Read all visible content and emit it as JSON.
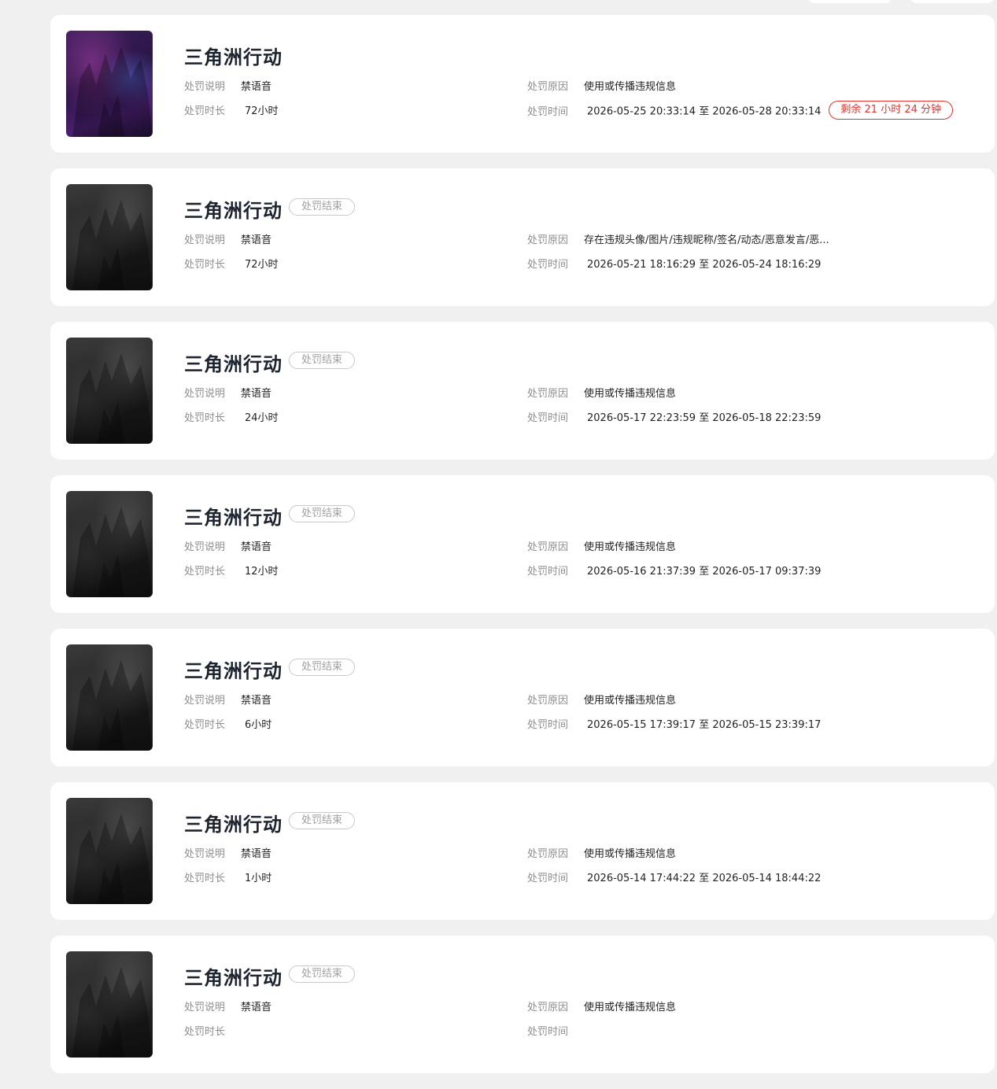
{
  "labels": {
    "desc": "处罚说明",
    "duration": "处罚时长",
    "reason": "处罚原因",
    "time": "处罚时间",
    "ended": "处罚结束"
  },
  "records": [
    {
      "game": "三角洲行动",
      "status": "active",
      "desc": "禁语音",
      "duration": "72小时",
      "reason": "使用或传播违规信息",
      "time": "2026-05-25 20:33:14 至 2026-05-28 20:33:14",
      "remaining": "剩余 21 小时 24 分钟"
    },
    {
      "game": "三角洲行动",
      "status": "ended",
      "desc": "禁语音",
      "duration": "72小时",
      "reason": "存在违规头像/图片/违规昵称/签名/动态/恶意发言/恶...",
      "time": "2026-05-21 18:16:29 至 2026-05-24 18:16:29"
    },
    {
      "game": "三角洲行动",
      "status": "ended",
      "desc": "禁语音",
      "duration": "24小时",
      "reason": "使用或传播违规信息",
      "time": "2026-05-17 22:23:59 至 2026-05-18 22:23:59"
    },
    {
      "game": "三角洲行动",
      "status": "ended",
      "desc": "禁语音",
      "duration": "12小时",
      "reason": "使用或传播违规信息",
      "time": "2026-05-16 21:37:39 至 2026-05-17 09:37:39"
    },
    {
      "game": "三角洲行动",
      "status": "ended",
      "desc": "禁语音",
      "duration": "6小时",
      "reason": "使用或传播违规信息",
      "time": "2026-05-15 17:39:17 至 2026-05-15 23:39:17"
    },
    {
      "game": "三角洲行动",
      "status": "ended",
      "desc": "禁语音",
      "duration": "1小时",
      "reason": "使用或传播违规信息",
      "time": "2026-05-14 17:44:22 至 2026-05-14 18:44:22"
    },
    {
      "game": "三角洲行动",
      "status": "ended",
      "desc": "禁语音",
      "duration": "",
      "reason": "使用或传播违规信息",
      "time": ""
    }
  ]
}
